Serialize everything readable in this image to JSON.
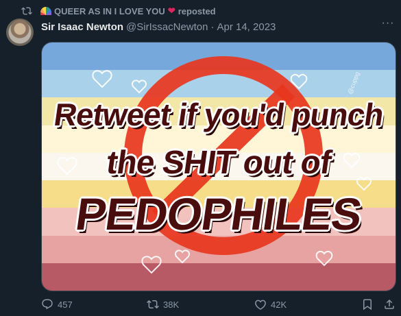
{
  "repost": {
    "icon": "repost-icon",
    "user": "QUEER AS IN I LOVE YOU",
    "emoji_after": "❤",
    "suffix": "reposted"
  },
  "post": {
    "author_name": "Sir Isaac Newton",
    "handle": "@SirIssacNewton",
    "separator": "·",
    "date": "Apr 14, 2023",
    "more_icon": "more-icon",
    "more_label": "···"
  },
  "media": {
    "line1": "Retweet if you'd punch",
    "line2": "the SHIT out of",
    "line3": "PEDOPHILES",
    "watermark": "@cuppg",
    "stripe_colors": [
      "#77a8dc",
      "#a9d1e9",
      "#f3e7a8",
      "#fff6d8",
      "#fbf7ef",
      "#f6dd8a",
      "#f2c3be",
      "#e7a3a2",
      "#b85a66"
    ]
  },
  "actions": {
    "replies": "457",
    "reposts": "38K",
    "likes": "42K"
  },
  "colors": {
    "background": "#15202b",
    "muted": "#8b98a5",
    "text": "#e7e9ea",
    "ban_symbol": "#e8361e"
  }
}
